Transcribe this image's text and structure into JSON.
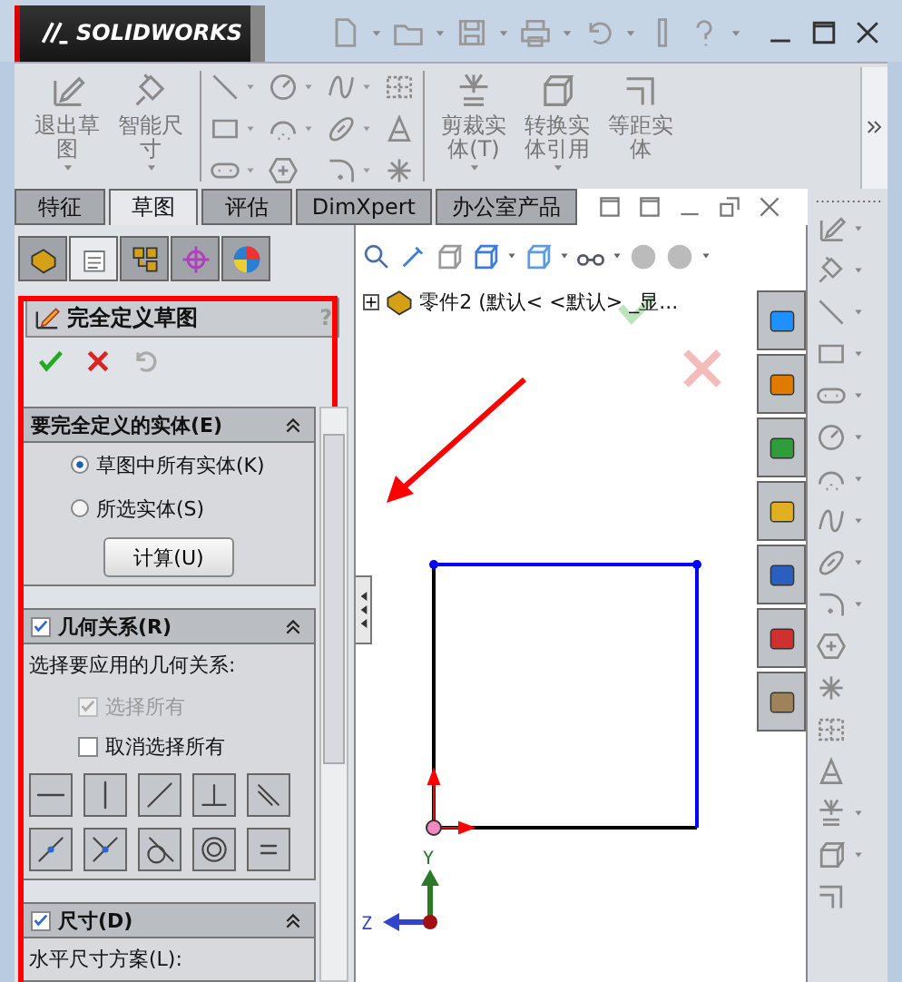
{
  "title_bar": {
    "logo": "SOLIDWORKS"
  },
  "ribbon": {
    "buttons": [
      {
        "label": "退出草图",
        "has_menu": true
      },
      {
        "label": "智能尺寸",
        "has_menu": true
      },
      {
        "label": "剪裁实体(T)",
        "has_menu": true
      },
      {
        "label": "转换实体引用",
        "has_menu": true
      },
      {
        "label": "等距实体",
        "has_menu": false
      }
    ]
  },
  "command_tabs": [
    {
      "label": "特征",
      "selected": false
    },
    {
      "label": "草图",
      "selected": true
    },
    {
      "label": "评估",
      "selected": false
    },
    {
      "label": "DimXpert",
      "selected": false
    },
    {
      "label": "办公室产品",
      "selected": false
    }
  ],
  "panel_tabs": [
    {
      "selected": false
    },
    {
      "selected": true
    },
    {
      "selected": false
    },
    {
      "selected": false
    },
    {
      "selected": false
    }
  ],
  "property_manager": {
    "title": "完全定义草图",
    "help": "?",
    "sections": [
      {
        "kind": "entities",
        "title": "要完全定义的实体(E)",
        "options": [
          {
            "label": "草图中所有实体(K)",
            "selected": true
          },
          {
            "label": "所选实体(S)",
            "selected": false
          }
        ],
        "button": "计算(U)"
      },
      {
        "kind": "relations",
        "title": "几何关系(R)",
        "checked": true,
        "prompt": "选择要应用的几何关系:",
        "select_all": {
          "label": "选择所有",
          "checked": true,
          "disabled": true
        },
        "deselect_all": {
          "label": "取消选择所有",
          "checked": false,
          "disabled": false
        }
      },
      {
        "kind": "dimensions",
        "title": "尺寸(D)",
        "checked": true,
        "prompt": "水平尺寸方案(L):"
      }
    ]
  },
  "feature_tree": {
    "expanded": false,
    "label": "零件2  (默认< <默认> _显..."
  },
  "triad": {
    "y": "Y",
    "z": "Z"
  }
}
